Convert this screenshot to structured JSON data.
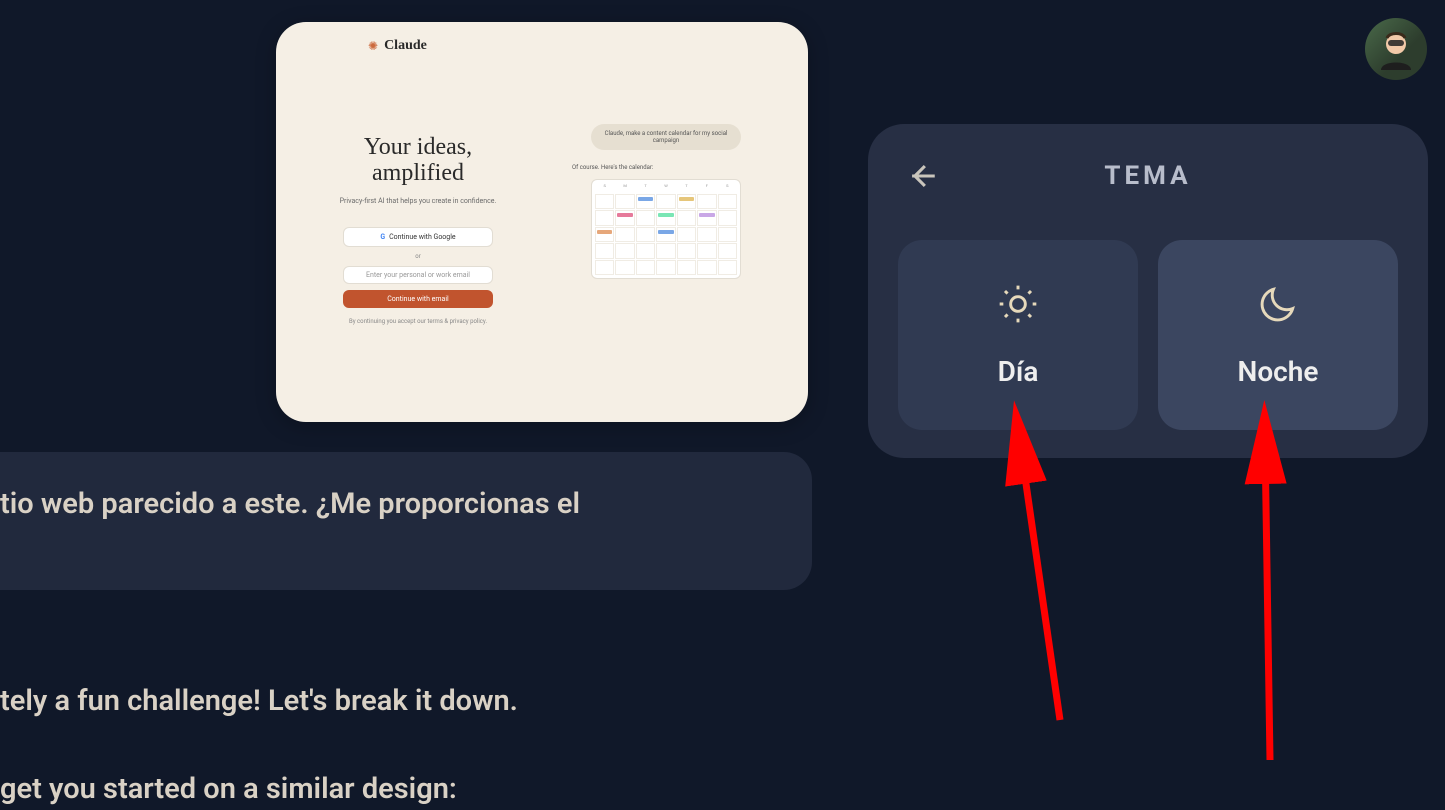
{
  "avatar": {
    "alt": "user-avatar"
  },
  "preview": {
    "brand": "Claude",
    "heading_line1": "Your ideas,",
    "heading_line2": "amplified",
    "subtext": "Privacy-first AI that helps you create in confidence.",
    "google_btn": "Continue with Google",
    "or": "or",
    "email_placeholder": "Enter your personal or work email",
    "cta": "Continue with email",
    "fineprint": "By continuing you accept our terms & privacy policy.",
    "prompt": "Claude, make a content calendar for my social campaign",
    "reply": "Of course. Here's the calendar:"
  },
  "chat": {
    "user_message": "tio web parecido a este. ¿Me proporcionas el",
    "assistant_line1": "tely a fun challenge! Let's break it down.",
    "assistant_line2": "get you started on a similar design:"
  },
  "theme_panel": {
    "title": "TEMA",
    "options": {
      "day": "Día",
      "night": "Noche"
    }
  }
}
